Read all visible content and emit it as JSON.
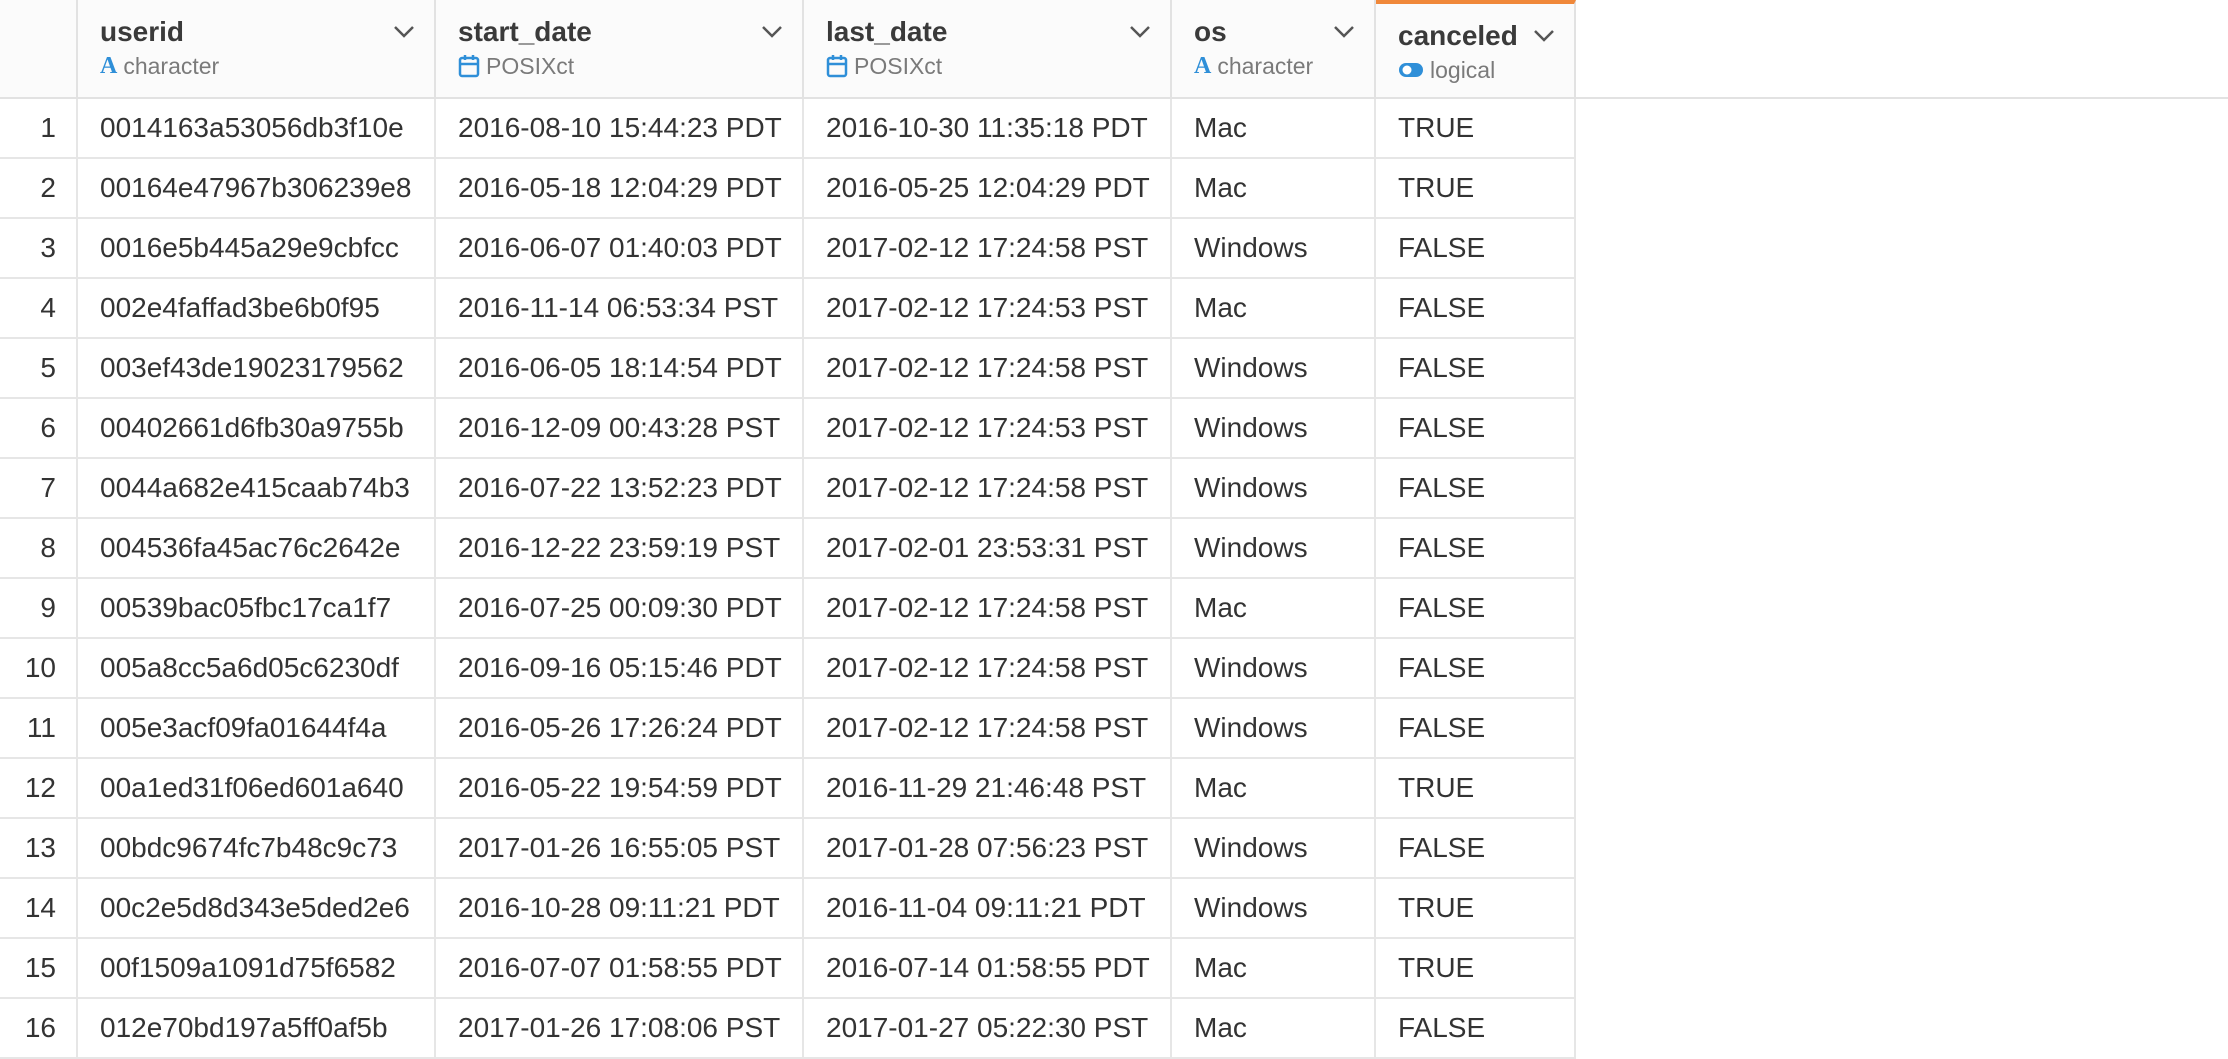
{
  "columns": [
    {
      "name": "userid",
      "type": "character",
      "icon": "character-type-icon"
    },
    {
      "name": "start_date",
      "type": "POSIXct",
      "icon": "calendar-icon"
    },
    {
      "name": "last_date",
      "type": "POSIXct",
      "icon": "calendar-icon"
    },
    {
      "name": "os",
      "type": "character",
      "icon": "character-type-icon"
    },
    {
      "name": "canceled",
      "type": "logical",
      "icon": "toggle-icon"
    }
  ],
  "accent_color": "#f0883a",
  "type_icon_color": "#2f8fd8",
  "rows": [
    {
      "n": "1",
      "userid": "0014163a53056db3f10e",
      "start_date": "2016-08-10 15:44:23 PDT",
      "last_date": "2016-10-30 11:35:18 PDT",
      "os": "Mac",
      "canceled": "TRUE"
    },
    {
      "n": "2",
      "userid": "00164e47967b306239e8",
      "start_date": "2016-05-18 12:04:29 PDT",
      "last_date": "2016-05-25 12:04:29 PDT",
      "os": "Mac",
      "canceled": "TRUE"
    },
    {
      "n": "3",
      "userid": "0016e5b445a29e9cbfcc",
      "start_date": "2016-06-07 01:40:03 PDT",
      "last_date": "2017-02-12 17:24:58 PST",
      "os": "Windows",
      "canceled": "FALSE"
    },
    {
      "n": "4",
      "userid": "002e4faffad3be6b0f95",
      "start_date": "2016-11-14 06:53:34 PST",
      "last_date": "2017-02-12 17:24:53 PST",
      "os": "Mac",
      "canceled": "FALSE"
    },
    {
      "n": "5",
      "userid": "003ef43de19023179562",
      "start_date": "2016-06-05 18:14:54 PDT",
      "last_date": "2017-02-12 17:24:58 PST",
      "os": "Windows",
      "canceled": "FALSE"
    },
    {
      "n": "6",
      "userid": "00402661d6fb30a9755b",
      "start_date": "2016-12-09 00:43:28 PST",
      "last_date": "2017-02-12 17:24:53 PST",
      "os": "Windows",
      "canceled": "FALSE"
    },
    {
      "n": "7",
      "userid": "0044a682e415caab74b3",
      "start_date": "2016-07-22 13:52:23 PDT",
      "last_date": "2017-02-12 17:24:58 PST",
      "os": "Windows",
      "canceled": "FALSE"
    },
    {
      "n": "8",
      "userid": "004536fa45ac76c2642e",
      "start_date": "2016-12-22 23:59:19 PST",
      "last_date": "2017-02-01 23:53:31 PST",
      "os": "Windows",
      "canceled": "FALSE"
    },
    {
      "n": "9",
      "userid": "00539bac05fbc17ca1f7",
      "start_date": "2016-07-25 00:09:30 PDT",
      "last_date": "2017-02-12 17:24:58 PST",
      "os": "Mac",
      "canceled": "FALSE"
    },
    {
      "n": "10",
      "userid": "005a8cc5a6d05c6230df",
      "start_date": "2016-09-16 05:15:46 PDT",
      "last_date": "2017-02-12 17:24:58 PST",
      "os": "Windows",
      "canceled": "FALSE"
    },
    {
      "n": "11",
      "userid": "005e3acf09fa01644f4a",
      "start_date": "2016-05-26 17:26:24 PDT",
      "last_date": "2017-02-12 17:24:58 PST",
      "os": "Windows",
      "canceled": "FALSE"
    },
    {
      "n": "12",
      "userid": "00a1ed31f06ed601a640",
      "start_date": "2016-05-22 19:54:59 PDT",
      "last_date": "2016-11-29 21:46:48 PST",
      "os": "Mac",
      "canceled": "TRUE"
    },
    {
      "n": "13",
      "userid": "00bdc9674fc7b48c9c73",
      "start_date": "2017-01-26 16:55:05 PST",
      "last_date": "2017-01-28 07:56:23 PST",
      "os": "Windows",
      "canceled": "FALSE"
    },
    {
      "n": "14",
      "userid": "00c2e5d8d343e5ded2e6",
      "start_date": "2016-10-28 09:11:21 PDT",
      "last_date": "2016-11-04 09:11:21 PDT",
      "os": "Windows",
      "canceled": "TRUE"
    },
    {
      "n": "15",
      "userid": "00f1509a1091d75f6582",
      "start_date": "2016-07-07 01:58:55 PDT",
      "last_date": "2016-07-14 01:58:55 PDT",
      "os": "Mac",
      "canceled": "TRUE"
    },
    {
      "n": "16",
      "userid": "012e70bd197a5ff0af5b",
      "start_date": "2017-01-26 17:08:06 PST",
      "last_date": "2017-01-27 05:22:30 PST",
      "os": "Mac",
      "canceled": "FALSE"
    }
  ]
}
